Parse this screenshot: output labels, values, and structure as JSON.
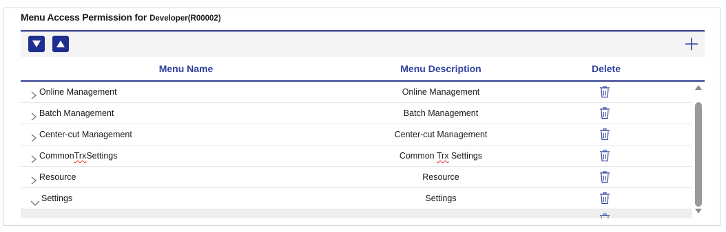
{
  "title": {
    "main": "Menu Access Permission for",
    "sub": "Developer(R00002)"
  },
  "toolbar": {
    "move_down_icon": "triangle-down-icon",
    "move_up_icon": "triangle-up-icon",
    "add_icon": "plus-icon"
  },
  "columns": {
    "name": "Menu Name",
    "description": "Menu Description",
    "delete": "Delete"
  },
  "rows": [
    {
      "name_parts": [
        "Online Management"
      ],
      "desc_parts": [
        "Online Management"
      ],
      "expanded": false
    },
    {
      "name_parts": [
        "Batch Management"
      ],
      "desc_parts": [
        "Batch Management"
      ],
      "expanded": false
    },
    {
      "name_parts": [
        "Center-cut Management"
      ],
      "desc_parts": [
        "Center-cut Management"
      ],
      "expanded": false
    },
    {
      "name_parts": [
        "Common ",
        "Trx",
        " Settings"
      ],
      "desc_parts": [
        "Common ",
        "Trx",
        " Settings"
      ],
      "expanded": false
    },
    {
      "name_parts": [
        "Resource"
      ],
      "desc_parts": [
        "Resource"
      ],
      "expanded": false
    },
    {
      "name_parts": [
        "Settings"
      ],
      "desc_parts": [
        "Settings"
      ],
      "expanded": true
    },
    {
      "name_parts": [
        ""
      ],
      "desc_parts": [
        ""
      ],
      "expanded": false,
      "selected": true
    }
  ],
  "colors": {
    "accent": "#2e3a8c",
    "header_text": "#2f3f9e",
    "button_bg": "#1f2f8f"
  }
}
